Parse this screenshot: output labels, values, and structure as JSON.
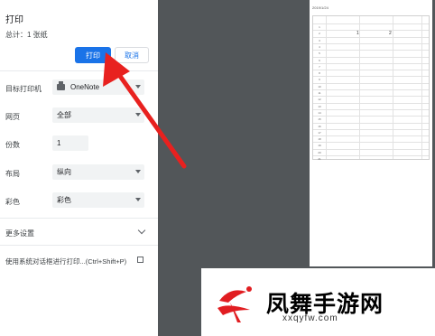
{
  "dialog": {
    "title": "打印",
    "summary": "总计：1 张纸",
    "print_label": "打印",
    "cancel_label": "取消"
  },
  "settings": {
    "destination": {
      "label": "目标打印机",
      "value": "OneNote"
    },
    "pages": {
      "label": "网页",
      "value": "全部"
    },
    "copies": {
      "label": "份数",
      "value": "1"
    },
    "layout": {
      "label": "布局",
      "value": "纵向"
    },
    "color": {
      "label": "彩色",
      "value": "彩色"
    },
    "more": {
      "label": "更多设置"
    },
    "system_dialog": {
      "label": "使用系统对话框进行打印...(Ctrl+Shift+P)"
    }
  },
  "preview": {
    "date": "2019/1/24",
    "col_values": [
      "1",
      "2"
    ],
    "row_numbers": [
      "1",
      "2",
      "3",
      "4",
      "5",
      "6",
      "7",
      "8",
      "9",
      "10",
      "11",
      "12",
      "13",
      "14",
      "15",
      "16",
      "17",
      "18",
      "19",
      "20",
      "21"
    ]
  },
  "watermark": {
    "brand": "凤舞手游网",
    "url": "xxqyfw.com"
  },
  "colors": {
    "accent": "#1a73e8",
    "arrow": "#e8211f",
    "preview_bg": "#525659"
  }
}
